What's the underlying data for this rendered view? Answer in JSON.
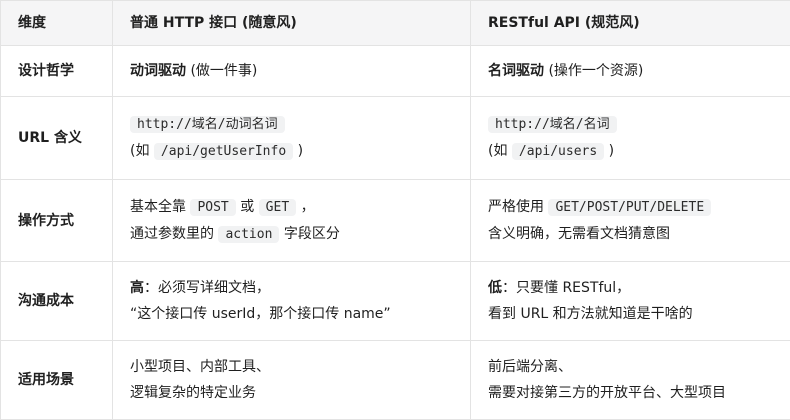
{
  "header": {
    "col1": "维度",
    "col2": "普通 HTTP 接口 (随意风)",
    "col3": "RESTful API (规范风)"
  },
  "rows": [
    {
      "label": "设计哲学",
      "http": {
        "bold": "动词驱动",
        "rest": " (做一件事)"
      },
      "rest": {
        "bold": "名词驱动",
        "rest": " (操作一个资源)"
      }
    },
    {
      "label": "URL 含义",
      "http": {
        "code1": "http://域名/动词名词",
        "pre": "(如 ",
        "code2": "/api/getUserInfo",
        "post": " )"
      },
      "rest": {
        "code1": "http://域名/名词",
        "pre": "(如 ",
        "code2": "/api/users",
        "post": " )"
      }
    },
    {
      "label": "操作方式",
      "http": {
        "t1": "基本全靠 ",
        "c1": "POST",
        "t2": " 或 ",
        "c2": "GET",
        "t3": " ，",
        "t4": "通过参数里的 ",
        "c3": "action",
        "t5": " 字段区分"
      },
      "rest": {
        "t1": "严格使用 ",
        "c1": "GET/POST/PUT/DELETE",
        "t2": "含义明确，无需看文档猜意图"
      }
    },
    {
      "label": "沟通成本",
      "http": {
        "bold": "高",
        "rest": "：必须写详细文档，",
        "line2": "“这个接口传 userId，那个接口传 name”"
      },
      "rest": {
        "bold": "低",
        "rest": "：只要懂 RESTful，",
        "line2": "看到 URL 和方法就知道是干啥的"
      }
    },
    {
      "label": "适用场景",
      "http": {
        "line1": "小型项目、内部工具、",
        "line2": "逻辑复杂的特定业务"
      },
      "rest": {
        "line1": "前后端分离、",
        "line2": "需要对接第三方的开放平台、大型项目"
      }
    }
  ]
}
